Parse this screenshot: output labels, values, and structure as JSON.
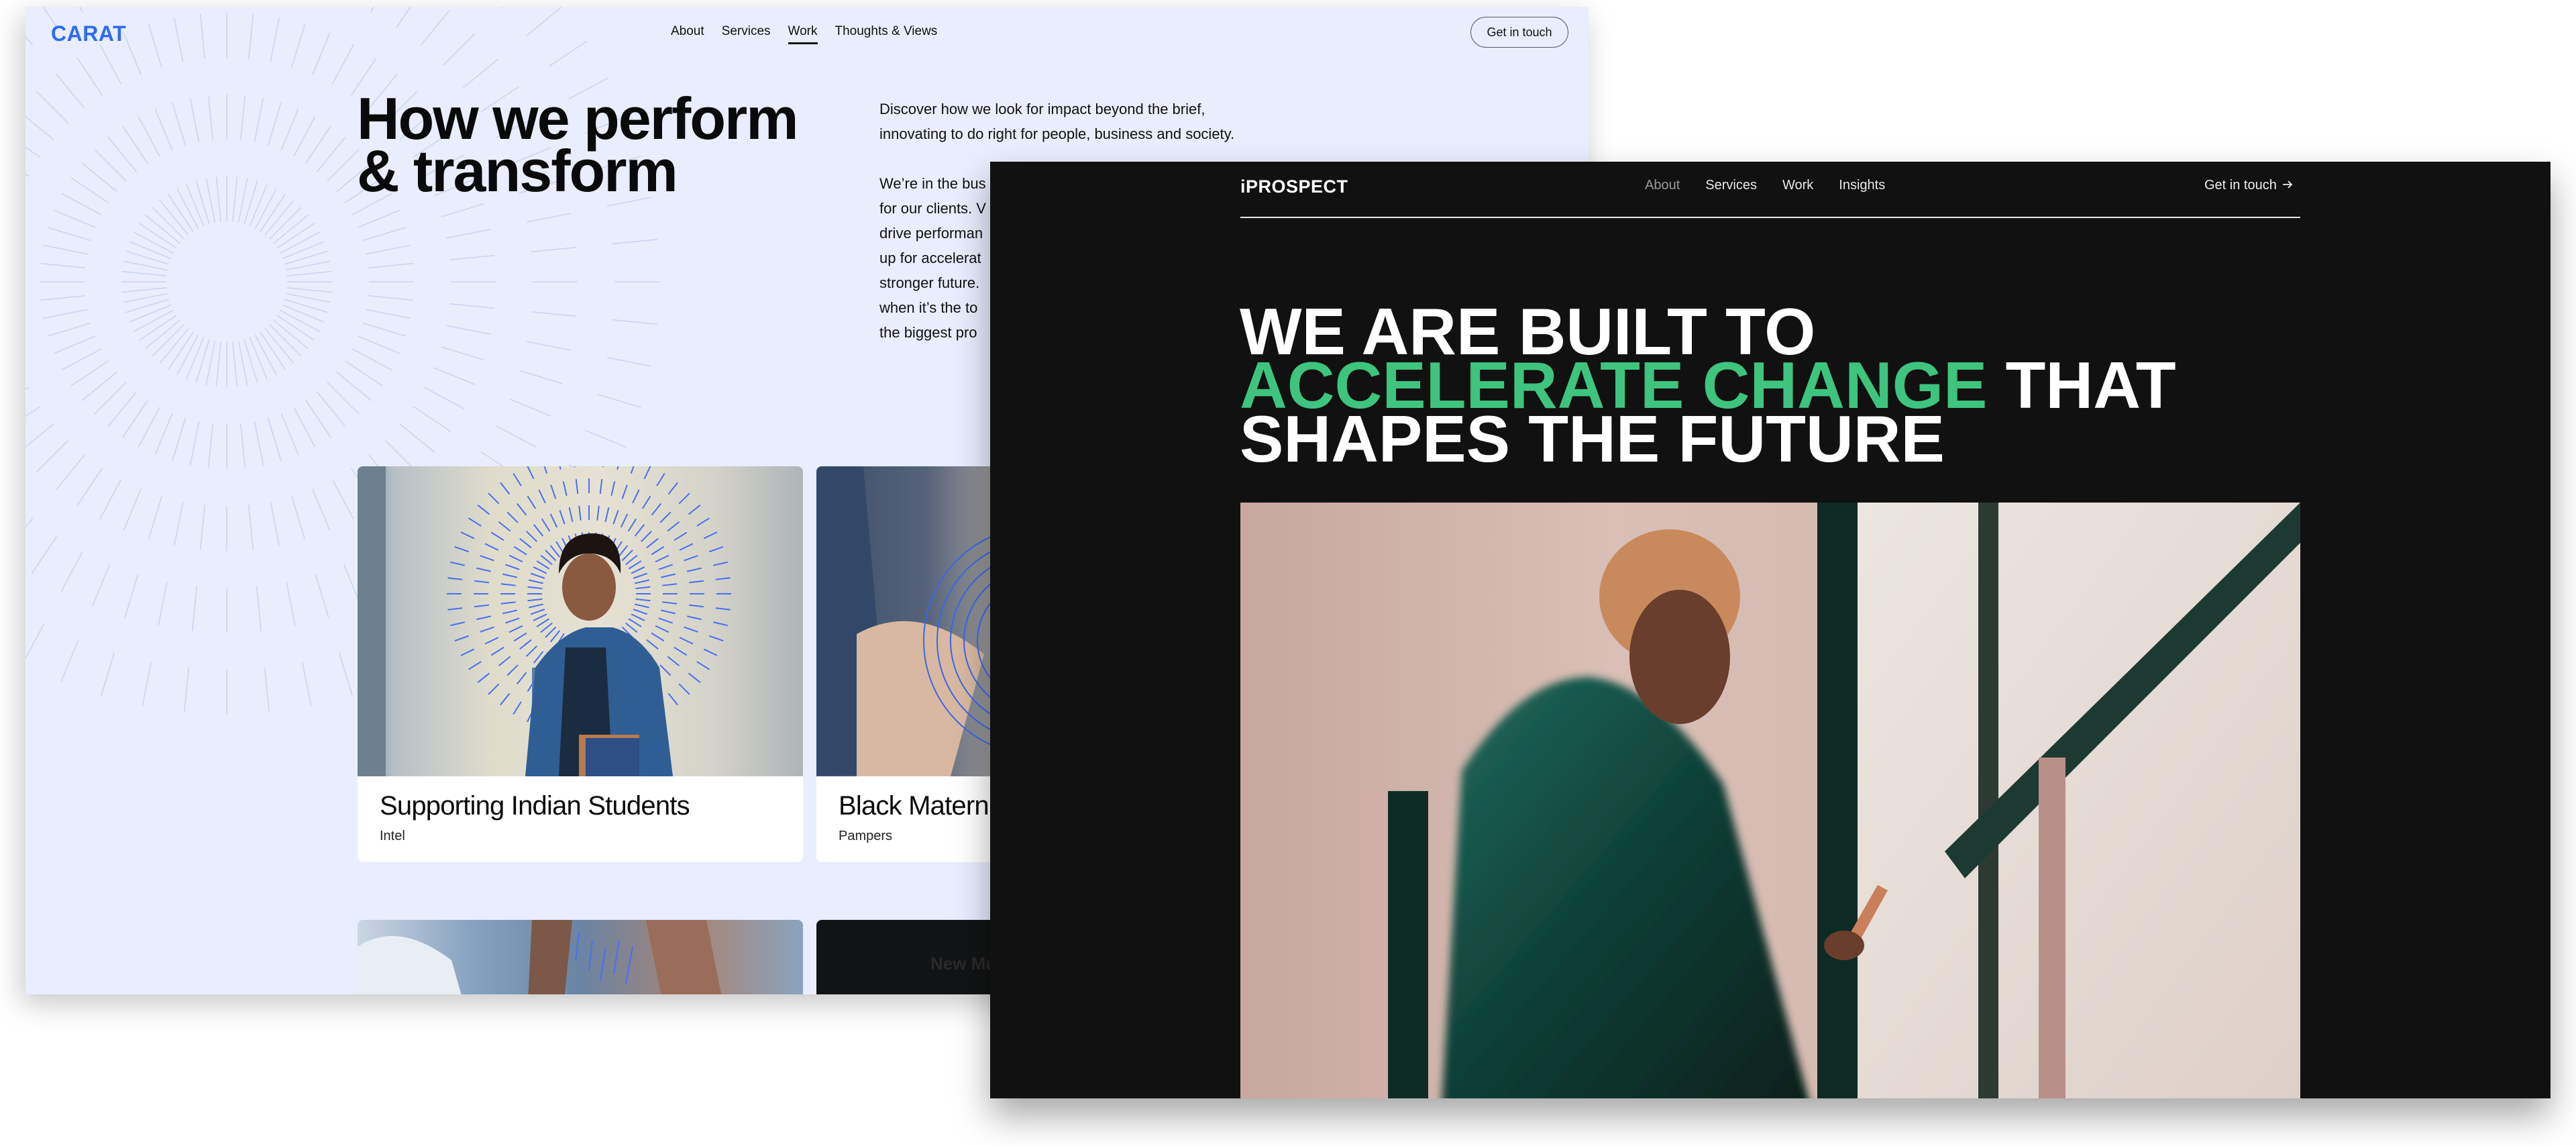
{
  "carat": {
    "logo": "CARAT",
    "nav": [
      {
        "label": "About",
        "active": false
      },
      {
        "label": "Services",
        "active": false
      },
      {
        "label": "Work",
        "active": true
      },
      {
        "label": "Thoughts & Views",
        "active": false
      }
    ],
    "cta_label": "Get in touch",
    "title_line1": "How we perform",
    "title_line2": "& transform",
    "intro_paragraph": "Discover how we look for impact beyond the brief, innovating to do right for people, business and society.",
    "body_paragraph_visible": "We’re in the bus… for our clients. V… drive performan… up for accelerat… stronger future.… when it’s the to… the biggest pro…",
    "body_lines_visible": [
      "We’re in the bus",
      "for our clients. V",
      "drive performan",
      "up for accelerat",
      "stronger future.",
      "when it’s the to",
      "the biggest pro"
    ],
    "cards": [
      {
        "title": "Supporting Indian Students",
        "client": "Intel",
        "image": "student-with-books-photo"
      },
      {
        "title": "Black Matern",
        "client": "Pampers",
        "image": "maternity-photo"
      },
      {
        "title": "",
        "client": "",
        "image": "dancers-photo"
      },
      {
        "title": "New Mus",
        "client": "",
        "image": "dark-music-photo"
      }
    ],
    "colors": {
      "brand": "#2f6bf2",
      "background": "#e9edfd"
    }
  },
  "iprospect": {
    "logo": "iPROSPECT",
    "nav": [
      {
        "label": "About",
        "muted": true
      },
      {
        "label": "Services",
        "muted": false
      },
      {
        "label": "Work",
        "muted": false
      },
      {
        "label": "Insights",
        "muted": false
      }
    ],
    "cta_label": "Get in touch",
    "cta_icon": "arrow-right-icon",
    "hero_line1": "WE ARE BUILT TO",
    "hero_green": "ACCELERATE CHANGE",
    "hero_line2_rest": " THAT",
    "hero_line3": "SHAPES THE FUTURE",
    "hero_image": "person-looking-at-phone-by-window-photo",
    "colors": {
      "accent": "#3ec47e",
      "background": "#111111"
    }
  }
}
